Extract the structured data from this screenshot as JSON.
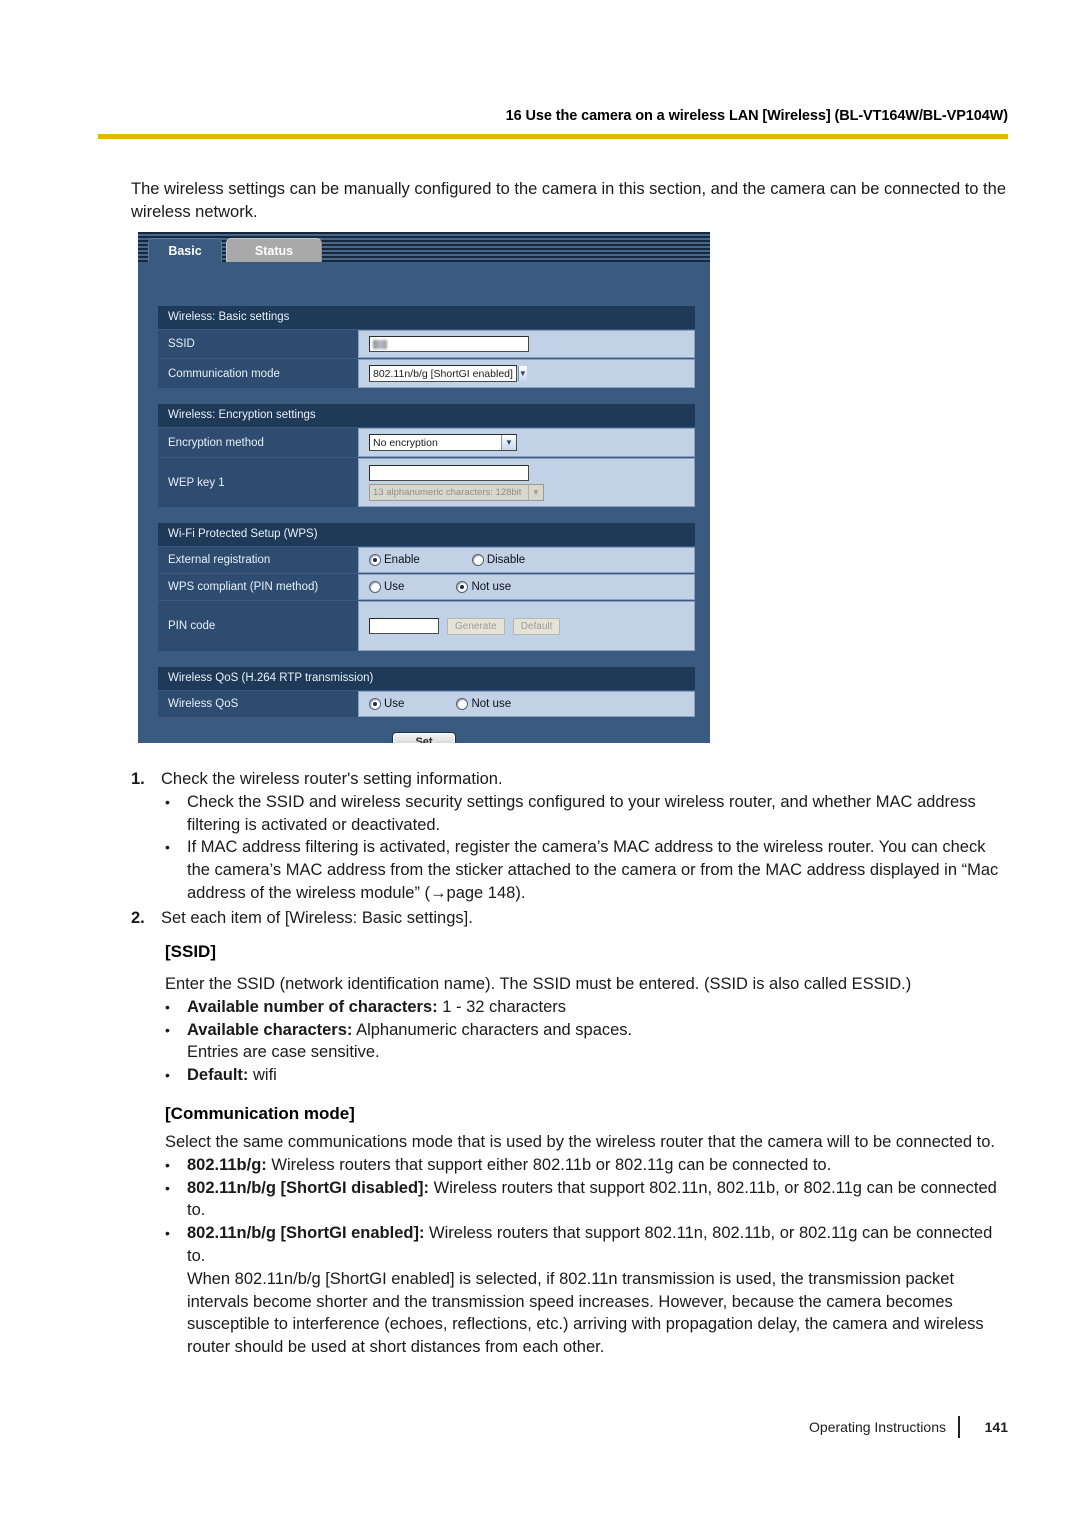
{
  "header": {
    "title": "16 Use the camera on a wireless LAN [Wireless] (BL-VT164W/BL-VP104W)"
  },
  "intro": "The wireless settings can be manually configured to the camera in this section, and the camera can be connected to the wireless network.",
  "screenshot": {
    "tabs": [
      {
        "label": "Basic",
        "active": true
      },
      {
        "label": "Status",
        "active": false
      }
    ],
    "sections": [
      {
        "heading": "Wireless: Basic settings",
        "rows": [
          {
            "label": "SSID",
            "control": "text",
            "value": ""
          },
          {
            "label": "Communication mode",
            "control": "select",
            "value": "802.11n/b/g [ShortGI enabled]"
          }
        ]
      },
      {
        "heading": "Wireless: Encryption settings",
        "rows": [
          {
            "label": "Encryption method",
            "control": "select",
            "value": "No encryption"
          },
          {
            "label": "WEP key 1",
            "control": "text+select",
            "value": "",
            "hint": "13 alphanumeric characters: 128bit"
          }
        ]
      },
      {
        "heading": "Wi-Fi Protected Setup (WPS)",
        "rows": [
          {
            "label": "External registration",
            "control": "radio",
            "options": [
              "Enable",
              "Disable"
            ],
            "selected": "Enable"
          },
          {
            "label": "WPS compliant (PIN method)",
            "control": "radio",
            "options": [
              "Use",
              "Not use"
            ],
            "selected": "Not use"
          },
          {
            "label": "PIN code",
            "control": "text+buttons",
            "value": "",
            "buttons": [
              "Generate",
              "Default"
            ]
          }
        ]
      },
      {
        "heading": "Wireless QoS (H.264 RTP transmission)",
        "rows": [
          {
            "label": "Wireless QoS",
            "control": "radio",
            "options": [
              "Use",
              "Not use"
            ],
            "selected": "Use"
          }
        ]
      }
    ],
    "set_button": "Set"
  },
  "steps": [
    {
      "num": "1.",
      "text": "Check the wireless router's setting information.",
      "bullets": [
        "Check the SSID and wireless security settings configured to your wireless router, and whether MAC address filtering is activated or deactivated.",
        "If MAC address filtering is activated, register the camera’s MAC address to the wireless router. You can check the camera’s MAC address from the sticker attached to the camera or from the MAC address displayed in “Mac address of the wireless module” (→page 148)."
      ]
    },
    {
      "num": "2.",
      "text": "Set each item of [Wireless: Basic settings].",
      "bullets": []
    }
  ],
  "ssid_section": {
    "heading": "[SSID]",
    "desc": "Enter the SSID (network identification name). The SSID must be entered. (SSID is also called ESSID.)",
    "b1_label": "Available number of characters:",
    "b1_value": " 1 - 32 characters",
    "b2_label": "Available characters:",
    "b2_value": " Alphanumeric characters and spaces.",
    "b2_line2": "Entries are case sensitive.",
    "b3_label": "Default:",
    "b3_value": " wifi"
  },
  "comm_section": {
    "heading": "[Communication mode]",
    "desc": "Select the same communications mode that is used by the wireless router that the camera will to be connected to.",
    "b1_label": "802.11b/g:",
    "b1_value": " Wireless routers that support either 802.11b or 802.11g can be connected to.",
    "b2_label": "802.11n/b/g [ShortGI disabled]:",
    "b2_value": " Wireless routers that support 802.11n, 802.11b, or 802.11g can be connected to.",
    "b3_label": "802.11n/b/g [ShortGI enabled]:",
    "b3_value": " Wireless routers that support 802.11n, 802.11b, or 802.11g can be connected to.",
    "note": "When 802.11n/b/g [ShortGI enabled] is selected, if 802.11n transmission is used, the transmission packet intervals become shorter and the transmission speed increases. However, because the camera becomes susceptible to interference (echoes, reflections, etc.) arriving with propagation delay, the camera and wireless router should be used at short distances from each other."
  },
  "footer": {
    "label": "Operating Instructions",
    "page": "141"
  }
}
